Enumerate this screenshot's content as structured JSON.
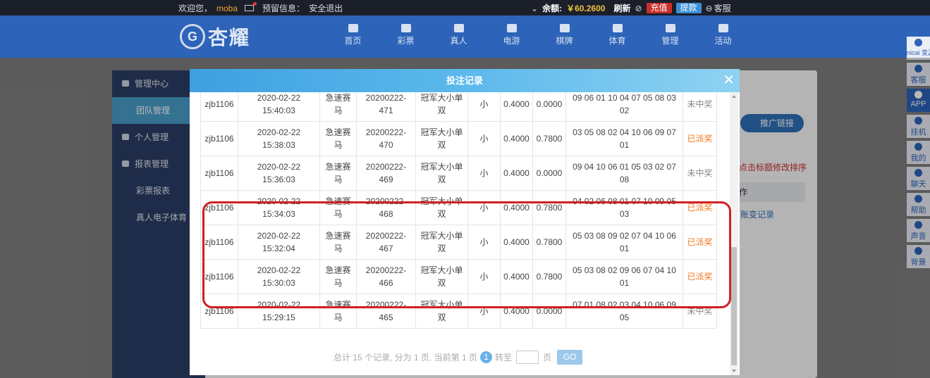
{
  "topbar": {
    "welcome": "欢迎您，",
    "username": "moba",
    "reserved_info": "预留信息：",
    "logout": "安全退出",
    "balance_label": "余额:",
    "balance_value": "￥60.2600",
    "refresh": "刷新",
    "deposit": "充值",
    "withdraw": "提款",
    "service": "客服"
  },
  "header": {
    "logo_text": "杏耀",
    "nav": [
      "首页",
      "彩票",
      "真人",
      "电游",
      "棋牌",
      "体育",
      "管理",
      "活动"
    ]
  },
  "sidebar": {
    "items": [
      "管理中心",
      "团队管理",
      "个人管理",
      "报表管理",
      "彩票报表",
      "真人电子体育"
    ]
  },
  "bg": {
    "promo_button": "推广链接",
    "sort_hint": "点击标题修改排序",
    "op_header": "作",
    "op_link": "账变记录"
  },
  "dock": {
    "items": [
      "nicai 变源认",
      "客服",
      "APP",
      "挂机",
      "我的",
      "聊天",
      "帮助",
      "声音",
      "背景"
    ]
  },
  "modal": {
    "title": "投注记录",
    "close": "✕",
    "rows": [
      {
        "user": "zjb1106",
        "date": "2020-02-22",
        "time": "15:40:03",
        "game1": "急速赛",
        "game2": "马",
        "issue1": "20200222-",
        "issue2": "471",
        "play1": "冠军大小单",
        "play2": "双",
        "content": "小",
        "bet": "0.4000",
        "win": "0.0000",
        "num1": "09 06 01 10 04 07 05 08 03",
        "num2": "02",
        "status": "未中奖"
      },
      {
        "user": "zjb1106",
        "date": "2020-02-22",
        "time": "15:38:03",
        "game1": "急速赛",
        "game2": "马",
        "issue1": "20200222-",
        "issue2": "470",
        "play1": "冠军大小单",
        "play2": "双",
        "content": "小",
        "bet": "0.4000",
        "win": "0.7800",
        "num1": "03 05 08 02 04 10 06 09 07",
        "num2": "01",
        "status": "已派奖"
      },
      {
        "user": "zjb1106",
        "date": "2020-02-22",
        "time": "15:36:03",
        "game1": "急速赛",
        "game2": "马",
        "issue1": "20200222-",
        "issue2": "469",
        "play1": "冠军大小单",
        "play2": "双",
        "content": "小",
        "bet": "0.4000",
        "win": "0.0000",
        "num1": "09 04 10 06 01 05 03 02 07",
        "num2": "08",
        "status": "未中奖"
      },
      {
        "user": "zjb1106",
        "date": "2020-02-22",
        "time": "15:34:03",
        "game1": "急速赛",
        "game2": "马",
        "issue1": "20200222-",
        "issue2": "468",
        "play1": "冠军大小单",
        "play2": "双",
        "content": "小",
        "bet": "0.4000",
        "win": "0.7800",
        "num1": "04 02 06 08 01 07 10 09 05",
        "num2": "03",
        "status": "已派奖"
      },
      {
        "user": "zjb1106",
        "date": "2020-02-22",
        "time": "15:32:04",
        "game1": "急速赛",
        "game2": "马",
        "issue1": "20200222-",
        "issue2": "467",
        "play1": "冠军大小单",
        "play2": "双",
        "content": "小",
        "bet": "0.4000",
        "win": "0.7800",
        "num1": "05 03 08 09 02 07 04 10 06",
        "num2": "01",
        "status": "已派奖"
      },
      {
        "user": "zjb1106",
        "date": "2020-02-22",
        "time": "15:30:03",
        "game1": "急速赛",
        "game2": "马",
        "issue1": "20200222-",
        "issue2": "466",
        "play1": "冠军大小单",
        "play2": "双",
        "content": "小",
        "bet": "0.4000",
        "win": "0.7800",
        "num1": "05 03 08 02 09 06 07 04 10",
        "num2": "01",
        "status": "已派奖"
      },
      {
        "user": "zjb1106",
        "date": "2020-02-22",
        "time": "15:29:15",
        "game1": "急速赛",
        "game2": "马",
        "issue1": "20200222-",
        "issue2": "465",
        "play1": "冠军大小单",
        "play2": "双",
        "content": "小",
        "bet": "0.4000",
        "win": "0.0000",
        "num1": "07 01 08 02 03 04 10 06 09",
        "num2": "05",
        "status": "未中奖"
      }
    ],
    "pager": {
      "summary": "总计 15 个记录, 分为 1 页, 当前第 1 页",
      "current": "1",
      "goto": "转至",
      "page_unit": "页",
      "go": "GO"
    }
  },
  "colors": {
    "paid_status": "#f07820",
    "highlight": "#d11f26",
    "header_bg": "#2d63b9"
  }
}
